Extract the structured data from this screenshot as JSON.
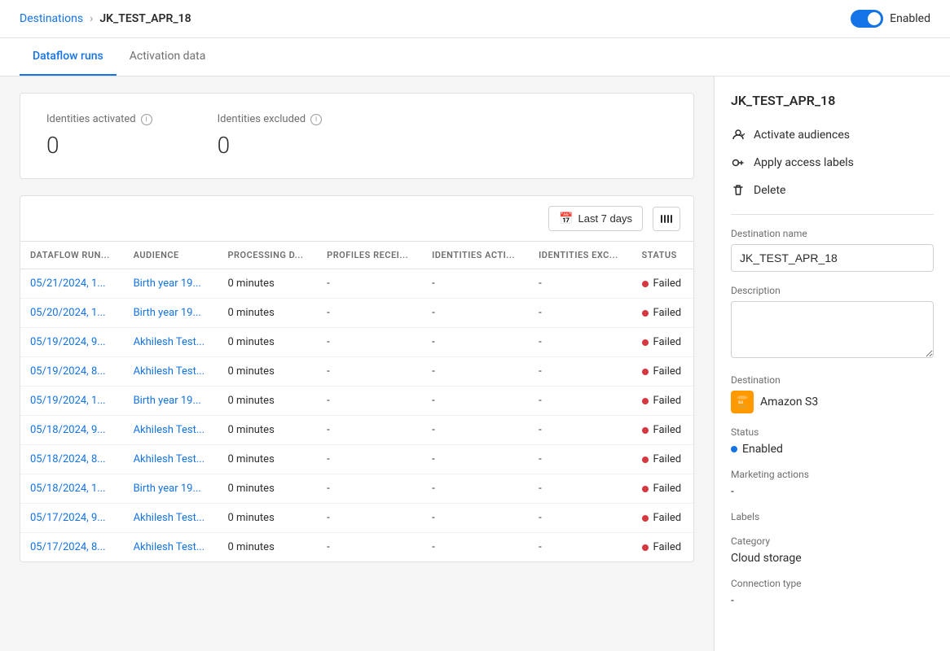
{
  "breadcrumb": {
    "parent": "Destinations",
    "current": "JK_TEST_APR_18"
  },
  "toggle": {
    "enabled": true,
    "label": "Enabled"
  },
  "tabs": [
    {
      "id": "dataflow-runs",
      "label": "Dataflow runs",
      "active": true
    },
    {
      "id": "activation-data",
      "label": "Activation data",
      "active": false
    }
  ],
  "stats": {
    "identities_activated_label": "Identities activated",
    "identities_activated_value": "0",
    "identities_excluded_label": "Identities excluded",
    "identities_excluded_value": "0"
  },
  "table_toolbar": {
    "filter_label": "Last 7 days"
  },
  "table": {
    "columns": [
      "DATAFLOW RUN...",
      "AUDIENCE",
      "PROCESSING D...",
      "PROFILES RECEI...",
      "IDENTITIES ACTI...",
      "IDENTITIES EXC...",
      "STATUS"
    ],
    "rows": [
      {
        "run": "05/21/2024, 1...",
        "audience": "Birth year 19...",
        "processing": "0 minutes",
        "profiles": "-",
        "identities_act": "-",
        "identities_exc": "-",
        "status": "Failed"
      },
      {
        "run": "05/20/2024, 1...",
        "audience": "Birth year 19...",
        "processing": "0 minutes",
        "profiles": "-",
        "identities_act": "-",
        "identities_exc": "-",
        "status": "Failed"
      },
      {
        "run": "05/19/2024, 9...",
        "audience": "Akhilesh Test...",
        "processing": "0 minutes",
        "profiles": "-",
        "identities_act": "-",
        "identities_exc": "-",
        "status": "Failed"
      },
      {
        "run": "05/19/2024, 8...",
        "audience": "Akhilesh Test...",
        "processing": "0 minutes",
        "profiles": "-",
        "identities_act": "-",
        "identities_exc": "-",
        "status": "Failed"
      },
      {
        "run": "05/19/2024, 1...",
        "audience": "Birth year 19...",
        "processing": "0 minutes",
        "profiles": "-",
        "identities_act": "-",
        "identities_exc": "-",
        "status": "Failed"
      },
      {
        "run": "05/18/2024, 9...",
        "audience": "Akhilesh Test...",
        "processing": "0 minutes",
        "profiles": "-",
        "identities_act": "-",
        "identities_exc": "-",
        "status": "Failed"
      },
      {
        "run": "05/18/2024, 8...",
        "audience": "Akhilesh Test...",
        "processing": "0 minutes",
        "profiles": "-",
        "identities_act": "-",
        "identities_exc": "-",
        "status": "Failed"
      },
      {
        "run": "05/18/2024, 1...",
        "audience": "Birth year 19...",
        "processing": "0 minutes",
        "profiles": "-",
        "identities_act": "-",
        "identities_exc": "-",
        "status": "Failed"
      },
      {
        "run": "05/17/2024, 9...",
        "audience": "Akhilesh Test...",
        "processing": "0 minutes",
        "profiles": "-",
        "identities_act": "-",
        "identities_exc": "-",
        "status": "Failed"
      },
      {
        "run": "05/17/2024, 8...",
        "audience": "Akhilesh Test...",
        "processing": "0 minutes",
        "profiles": "-",
        "identities_act": "-",
        "identities_exc": "-",
        "status": "Failed"
      }
    ]
  },
  "right_panel": {
    "title": "JK_TEST_APR_18",
    "actions": [
      {
        "id": "activate-audiences",
        "label": "Activate audiences",
        "icon": "audience-icon"
      },
      {
        "id": "apply-access-labels",
        "label": "Apply access labels",
        "icon": "key-icon"
      },
      {
        "id": "delete",
        "label": "Delete",
        "icon": "trash-icon"
      }
    ],
    "fields": {
      "destination_name_label": "Destination name",
      "destination_name_value": "JK_TEST_APR_18",
      "description_label": "Description",
      "description_value": "",
      "destination_label": "Destination",
      "destination_value": "Amazon S3",
      "status_label": "Status",
      "status_value": "Enabled",
      "marketing_actions_label": "Marketing actions",
      "marketing_actions_value": "-",
      "labels_label": "Labels",
      "labels_value": "",
      "category_label": "Category",
      "category_value": "Cloud storage",
      "connection_type_label": "Connection type",
      "connection_type_value": "-"
    }
  }
}
